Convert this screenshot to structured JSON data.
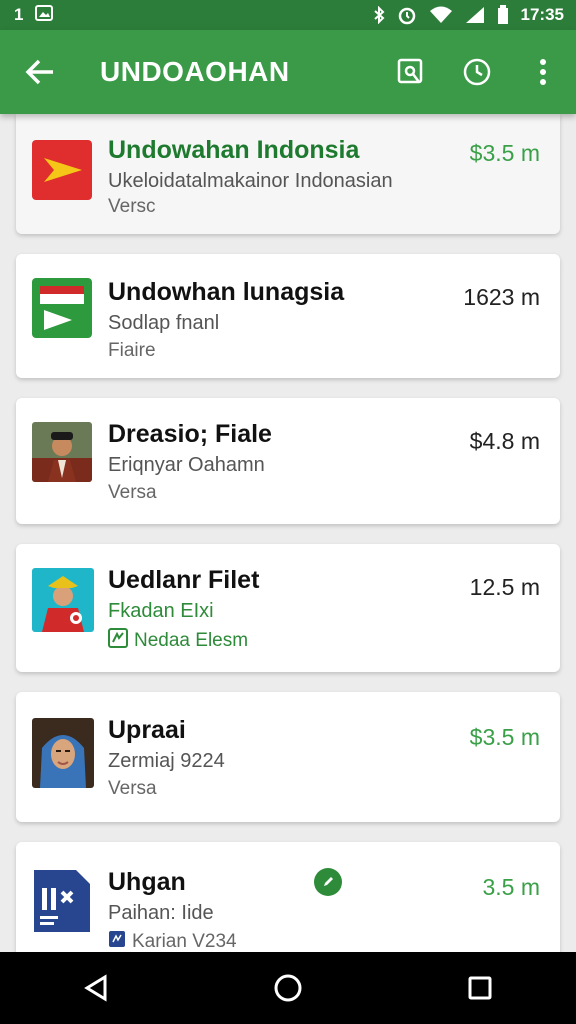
{
  "status_bar": {
    "left_text": "1",
    "time": "17:35",
    "icons": [
      "notification-icon",
      "image-icon",
      "bluetooth-icon",
      "alarm-icon",
      "wifi-icon",
      "signal-icon",
      "battery-icon"
    ]
  },
  "app_bar": {
    "title": "UNDOAOHAN",
    "icons": [
      "back-arrow-icon",
      "search-icon",
      "clock-icon",
      "more-vert-icon"
    ]
  },
  "items": [
    {
      "title": "Undowahan Indonsia",
      "subtitle": "Ukeloidatalmakainor Indonasian",
      "meta": "Versc",
      "price": "$3.5 m",
      "price_color": "#3aa048",
      "title_color": "#1e7a2e",
      "thumb": "red-arrow-logo"
    },
    {
      "title": "Undowhan lunagsia",
      "subtitle": "Sodlap fnanl",
      "meta": "Fiaire",
      "price": "1623 m",
      "thumb": "green-flag-logo"
    },
    {
      "title": "Dreasio; Fiale",
      "subtitle": "Eriqnyar Oahamn",
      "meta": "Versa",
      "price": "$4.8 m",
      "thumb": "man-portrait"
    },
    {
      "title": "Uedlanr Filet",
      "subtitle": "Fkadan EIxi",
      "meta": "Nedaa Elesm",
      "price": "12.5 m",
      "thumb": "costume-portrait"
    },
    {
      "title": "Upraai",
      "subtitle": "Zermiaj 9224",
      "meta": "Versa",
      "price": "$3.5 m",
      "price_color": "#3aa048",
      "thumb": "woman-hijab-portrait"
    },
    {
      "title": "Uhgan",
      "subtitle": "Paihan: Iide",
      "meta": "Karian V234",
      "price": "3.5 m",
      "price_color": "#3aa048",
      "thumb": "blue-document-logo"
    }
  ],
  "nav_bar": {
    "icons": [
      "nav-back-icon",
      "nav-home-icon",
      "nav-recents-icon"
    ]
  }
}
